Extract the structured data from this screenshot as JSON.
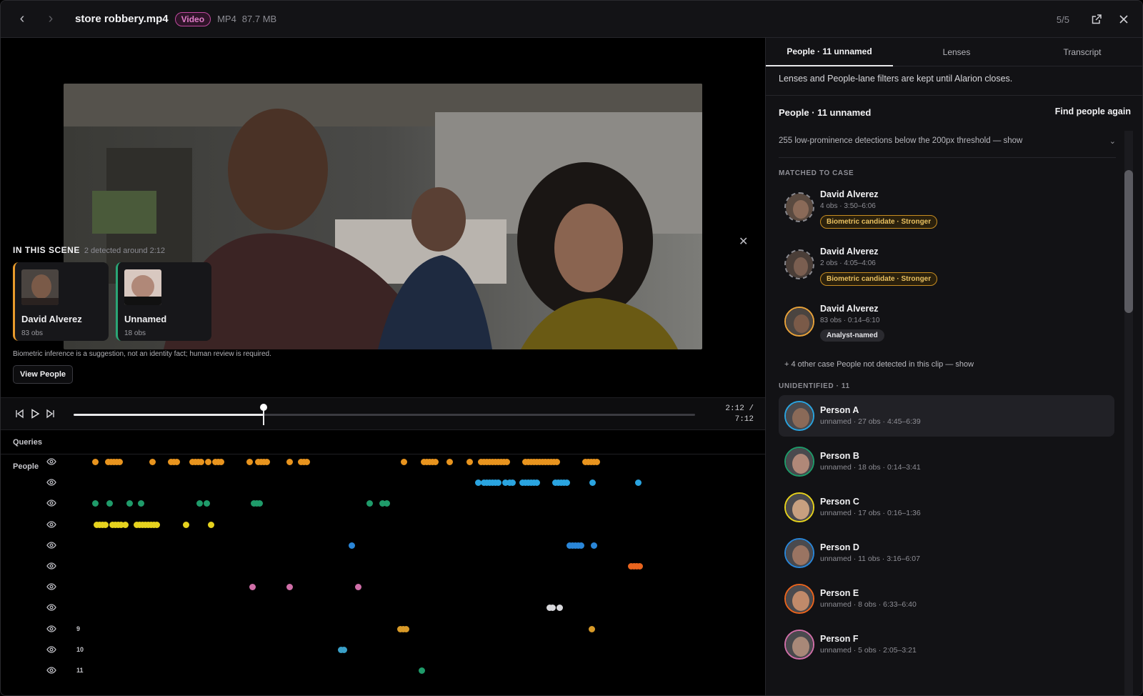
{
  "topbar": {
    "file_name": "store robbery.mp4",
    "type_badge": "Video",
    "format": "MP4",
    "size": "87.7 MB",
    "counter": "5/5"
  },
  "scene": {
    "title": "IN THIS SCENE",
    "subtitle": "2 detected around 2:12",
    "cards": [
      {
        "name": "David Alverez",
        "obs": "83 obs",
        "color": "#e89b2c"
      },
      {
        "name": "Unnamed",
        "obs": "18 obs",
        "color": "#2aa676"
      }
    ],
    "disclaimer": "Biometric inference is a suggestion, not an identity fact; human review is required.",
    "view_people": "View People"
  },
  "player": {
    "time_current": "2:12 /",
    "time_total": "7:12",
    "progress": 0.306
  },
  "timeline": {
    "queries_label": "Queries",
    "people_label": "People",
    "lane_numbers": [
      "",
      "",
      "",
      "",
      "",
      "",
      "",
      "",
      "9",
      "10",
      "11"
    ],
    "lane_colors": [
      "#e8941e",
      "#2aa4e0",
      "#1f9b6a",
      "#e6d21e",
      "#2a86d8",
      "#e8641e",
      "#d06fa8",
      "#d8d8dc",
      "#d89a28",
      "#3aa0c8",
      "#1f9b6a"
    ]
  },
  "right": {
    "tabs": [
      "People · 11 unnamed",
      "Lenses",
      "Transcript"
    ],
    "notice": "Lenses and People-lane filters are kept until Alarion closes.",
    "section_title": "People · 11 unnamed",
    "find_again": "Find people again",
    "low_prominence": "255 low-prominence detections below the 200px threshold — show",
    "matched_label": "MATCHED TO CASE",
    "matched": [
      {
        "name": "David Alverez",
        "sub": "4 obs · 3:50–6:06",
        "pill": "Biometric candidate · Stronger"
      },
      {
        "name": "David Alverez",
        "sub": "2 obs · 4:05–4:06",
        "pill": "Biometric candidate · Stronger"
      },
      {
        "name": "David Alverez",
        "sub": "83 obs · 0:14–6:10",
        "pill": "Analyst-named"
      }
    ],
    "other_case": "+ 4 other case People not detected in this clip — show",
    "unidentified_label": "UNIDENTIFIED · 11",
    "people": [
      {
        "name": "Person A",
        "sub": "unnamed · 27 obs · 4:45–6:39",
        "color": "#2aa4e0"
      },
      {
        "name": "Person B",
        "sub": "unnamed · 18 obs · 0:14–3:41",
        "color": "#1f9b6a"
      },
      {
        "name": "Person C",
        "sub": "unnamed · 17 obs · 0:16–1:36",
        "color": "#e6d21e"
      },
      {
        "name": "Person D",
        "sub": "unnamed · 11 obs · 3:16–6:07",
        "color": "#2a86d8"
      },
      {
        "name": "Person E",
        "sub": "unnamed · 8 obs · 6:33–6:40",
        "color": "#e8641e"
      },
      {
        "name": "Person F",
        "sub": "unnamed · 5 obs · 2:05–3:21",
        "color": "#d06fa8"
      }
    ]
  }
}
